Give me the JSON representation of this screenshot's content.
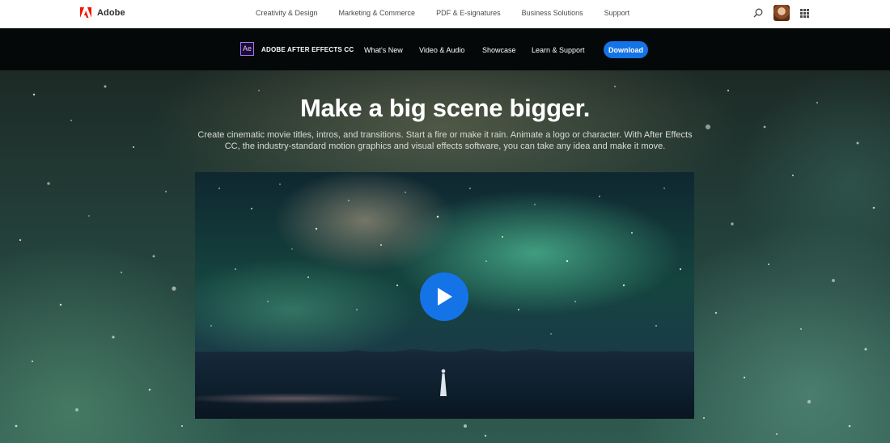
{
  "global_nav": {
    "brand": "Adobe",
    "links": [
      {
        "label": "Creativity & Design"
      },
      {
        "label": "Marketing & Commerce"
      },
      {
        "label": "PDF & E-signatures"
      },
      {
        "label": "Business Solutions"
      },
      {
        "label": "Support"
      }
    ],
    "icons": [
      "search-icon",
      "avatar",
      "apps-grid-icon"
    ]
  },
  "product_nav": {
    "badge": "Ae",
    "product_name": "ADOBE AFTER EFFECTS CC",
    "links": [
      {
        "label": "What's New"
      },
      {
        "label": "Video & Audio"
      },
      {
        "label": "Showcase"
      },
      {
        "label": "Learn & Support"
      }
    ],
    "cta": "Download"
  },
  "hero": {
    "title": "Make a big scene bigger.",
    "description": "Create cinematic movie titles, intros, and transitions. Start a fire or make it rain. Animate a logo or character. With After Effects CC, the industry-standard motion graphics and visual effects software, you can take any idea and make it move."
  },
  "colors": {
    "accent": "#1473e6",
    "product_badge_border": "#9e7bff",
    "product_badge_bg": "#1f0a33",
    "adobe_red": "#fa0f00"
  }
}
